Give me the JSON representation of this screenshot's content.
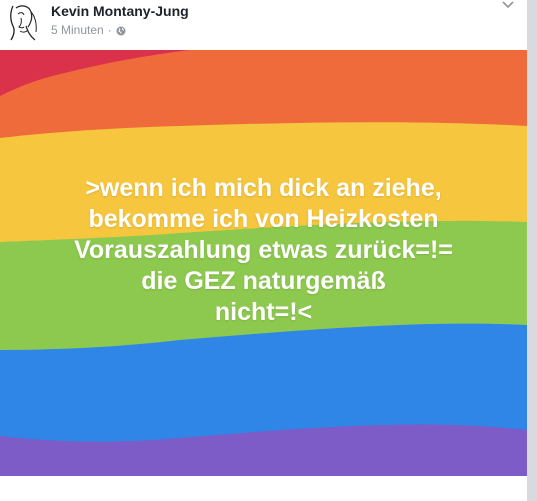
{
  "post": {
    "author_name": "Kevin Montany-Jung",
    "timestamp": "5 Minuten",
    "separator": "·",
    "privacy_icon": "globe-icon",
    "menu_icon": "chevron-down-icon",
    "image_text": ">wenn ich mich dick an ziehe,\nbekomme ich von Heizkosten\nVorauszahlung etwas zurück=!=\ndie GEZ naturgemäß\nnicht=!<"
  },
  "colors": {
    "red": "#d9324a",
    "orange": "#f06b3c",
    "yellow": "#f7c63f",
    "green": "#8ec94f",
    "blue": "#2f86e6",
    "purple": "#7d5cc7",
    "author_name": "#1d2129",
    "meta": "#90949c"
  }
}
